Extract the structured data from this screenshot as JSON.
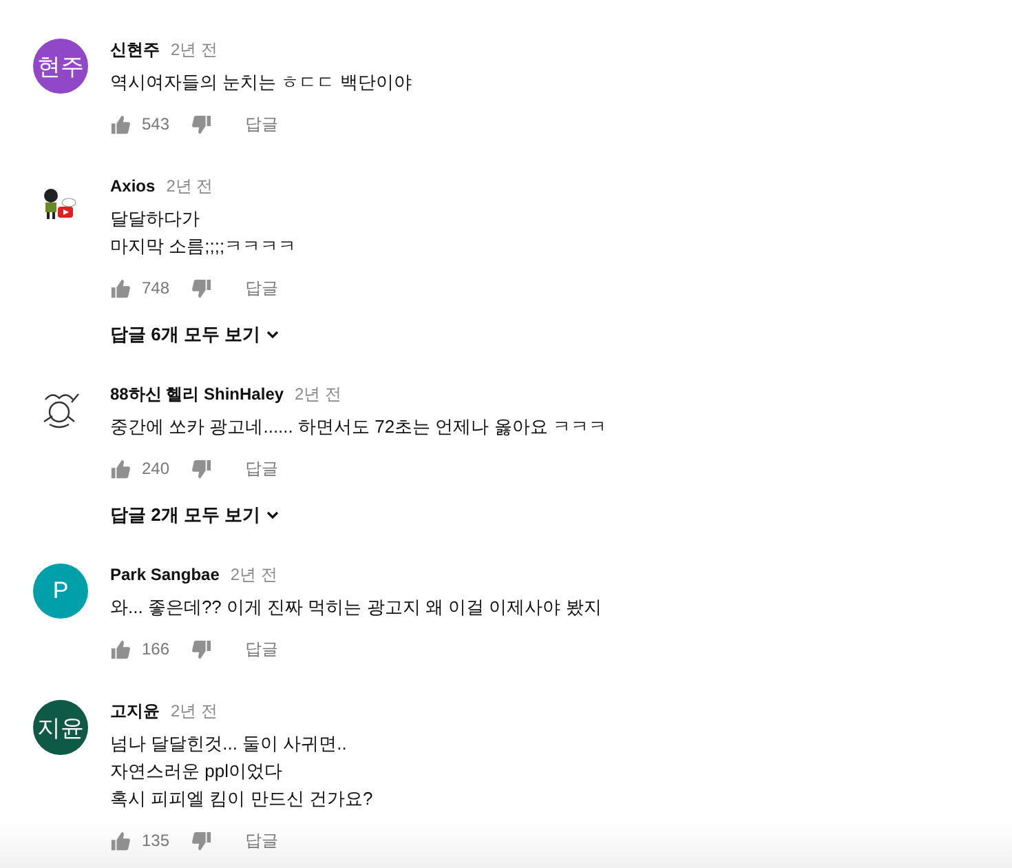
{
  "comments": [
    {
      "author": "신현주",
      "time": "2년 전",
      "avatar": {
        "kind": "initials",
        "text": "현주",
        "color": "#9148c8"
      },
      "lines": [
        "역시여자들의 눈치는 ㅎㄷㄷ 백단이야"
      ],
      "likes": "543",
      "reply_label": "답글"
    },
    {
      "author": "Axios",
      "time": "2년 전",
      "avatar": {
        "kind": "figure"
      },
      "lines": [
        "달달하다가",
        "마지막 소름;;;;ㅋㅋㅋㅋ"
      ],
      "likes": "748",
      "reply_label": "답글",
      "replies_link": "답글 6개 모두 보기"
    },
    {
      "author": "88하신 헬리 ShinHaley",
      "time": "2년 전",
      "avatar": {
        "kind": "doodle"
      },
      "lines": [
        "중간에 쏘카 광고네...... 하면서도  72초는 언제나 옳아요 ㅋㅋㅋ"
      ],
      "likes": "240",
      "reply_label": "답글",
      "replies_link": "답글 2개 모두 보기"
    },
    {
      "author": "Park Sangbae",
      "time": "2년 전",
      "avatar": {
        "kind": "initials",
        "text": "P",
        "color": "#00a0ab"
      },
      "lines": [
        "와... 좋은데?? 이게 진짜 먹히는 광고지 왜 이걸 이제사야 봤지"
      ],
      "likes": "166",
      "reply_label": "답글"
    },
    {
      "author": "고지윤",
      "time": "2년 전",
      "avatar": {
        "kind": "initials",
        "text": "지윤",
        "color": "#0e5a47"
      },
      "lines": [
        "넘나 달달힌것... 둘이 사귀면..",
        "자연스러운 ppl이었다",
        "혹시 피피엘 킴이 만드신 건가요?"
      ],
      "likes": "135",
      "reply_label": "답글"
    }
  ]
}
